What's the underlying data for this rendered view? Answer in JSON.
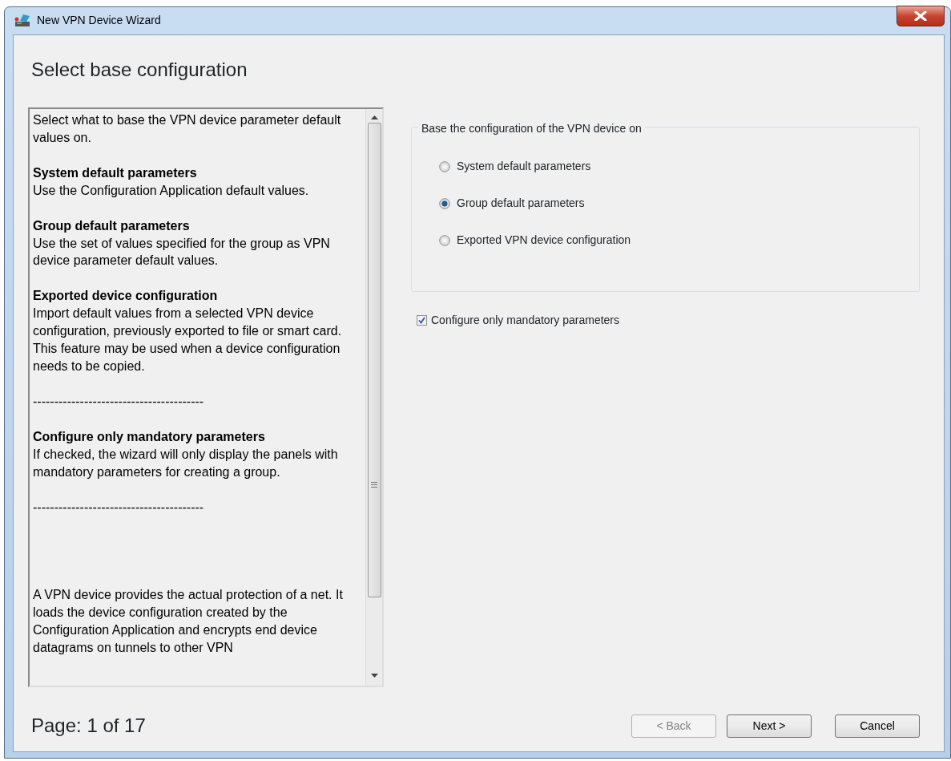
{
  "window": {
    "title": "New VPN Device Wizard"
  },
  "heading": "Select base configuration",
  "help": [
    {
      "kind": "plain",
      "text": "Select what to base the VPN device parameter default values on."
    },
    {
      "kind": "topic",
      "heading": "System default parameters",
      "body": "Use the Configuration Application default values."
    },
    {
      "kind": "topic",
      "heading": "Group default parameters",
      "body": "Use the set of values specified for the group as VPN device parameter default values."
    },
    {
      "kind": "topic",
      "heading": "Exported device configuration",
      "body": "Import default values from a selected VPN device configuration, previously exported to file or smart card. This feature may be used when a device configuration needs to be copied."
    },
    {
      "kind": "rule",
      "text": "----------------------------------------"
    },
    {
      "kind": "topic",
      "heading": "Configure only mandatory parameters",
      "body": "If checked, the wizard will only display the panels with mandatory parameters for creating a group."
    },
    {
      "kind": "rule",
      "text": "----------------------------------------"
    },
    {
      "kind": "closing",
      "text": "A VPN device provides the actual protection of a net. It loads the device configuration created by the Configuration Application and encrypts end device datagrams on tunnels to other VPN"
    }
  ],
  "base_group": {
    "legend": "Base the configuration of the VPN device on",
    "options": [
      {
        "label": "System default parameters",
        "selected": false
      },
      {
        "label": "Group default parameters",
        "selected": true
      },
      {
        "label": "Exported VPN device configuration",
        "selected": false
      }
    ]
  },
  "mandatory_only": {
    "label": "Configure only mandatory parameters",
    "checked": true
  },
  "page_indicator": "Page: 1 of 17",
  "buttons": [
    {
      "label": "< Back",
      "disabled": true
    },
    {
      "label": "Next >",
      "disabled": false
    },
    {
      "label": "Cancel",
      "disabled": false
    }
  ]
}
